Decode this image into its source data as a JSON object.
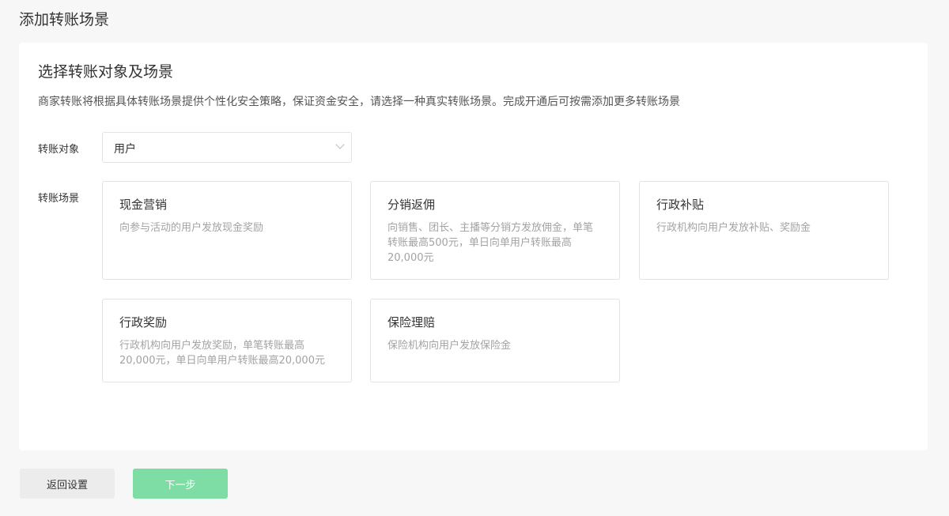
{
  "page_title": "添加转账场景",
  "section": {
    "title": "选择转账对象及场景",
    "description": "商家转账将根据具体转账场景提供个性化安全策略，保证资金安全，请选择一种真实转账场景。完成开通后可按需添加更多转账场景"
  },
  "target": {
    "label": "转账对象",
    "value": "用户"
  },
  "scenes": {
    "label": "转账场景",
    "items": [
      {
        "title": "现金营销",
        "desc": "向参与活动的用户发放现金奖励"
      },
      {
        "title": "分销返佣",
        "desc": "向销售、团长、主播等分销方发放佣金，单笔转账最高500元，单日向单用户转账最高20,000元"
      },
      {
        "title": "行政补贴",
        "desc": "行政机构向用户发放补贴、奖励金"
      },
      {
        "title": "行政奖励",
        "desc": "行政机构向用户发放奖励，单笔转账最高20,000元，单日向单用户转账最高20,000元"
      },
      {
        "title": "保险理赔",
        "desc": "保险机构向用户发放保险金"
      }
    ]
  },
  "buttons": {
    "back": "返回设置",
    "next": "下一步"
  },
  "colors": {
    "primary_disabled": "#7edda5"
  }
}
